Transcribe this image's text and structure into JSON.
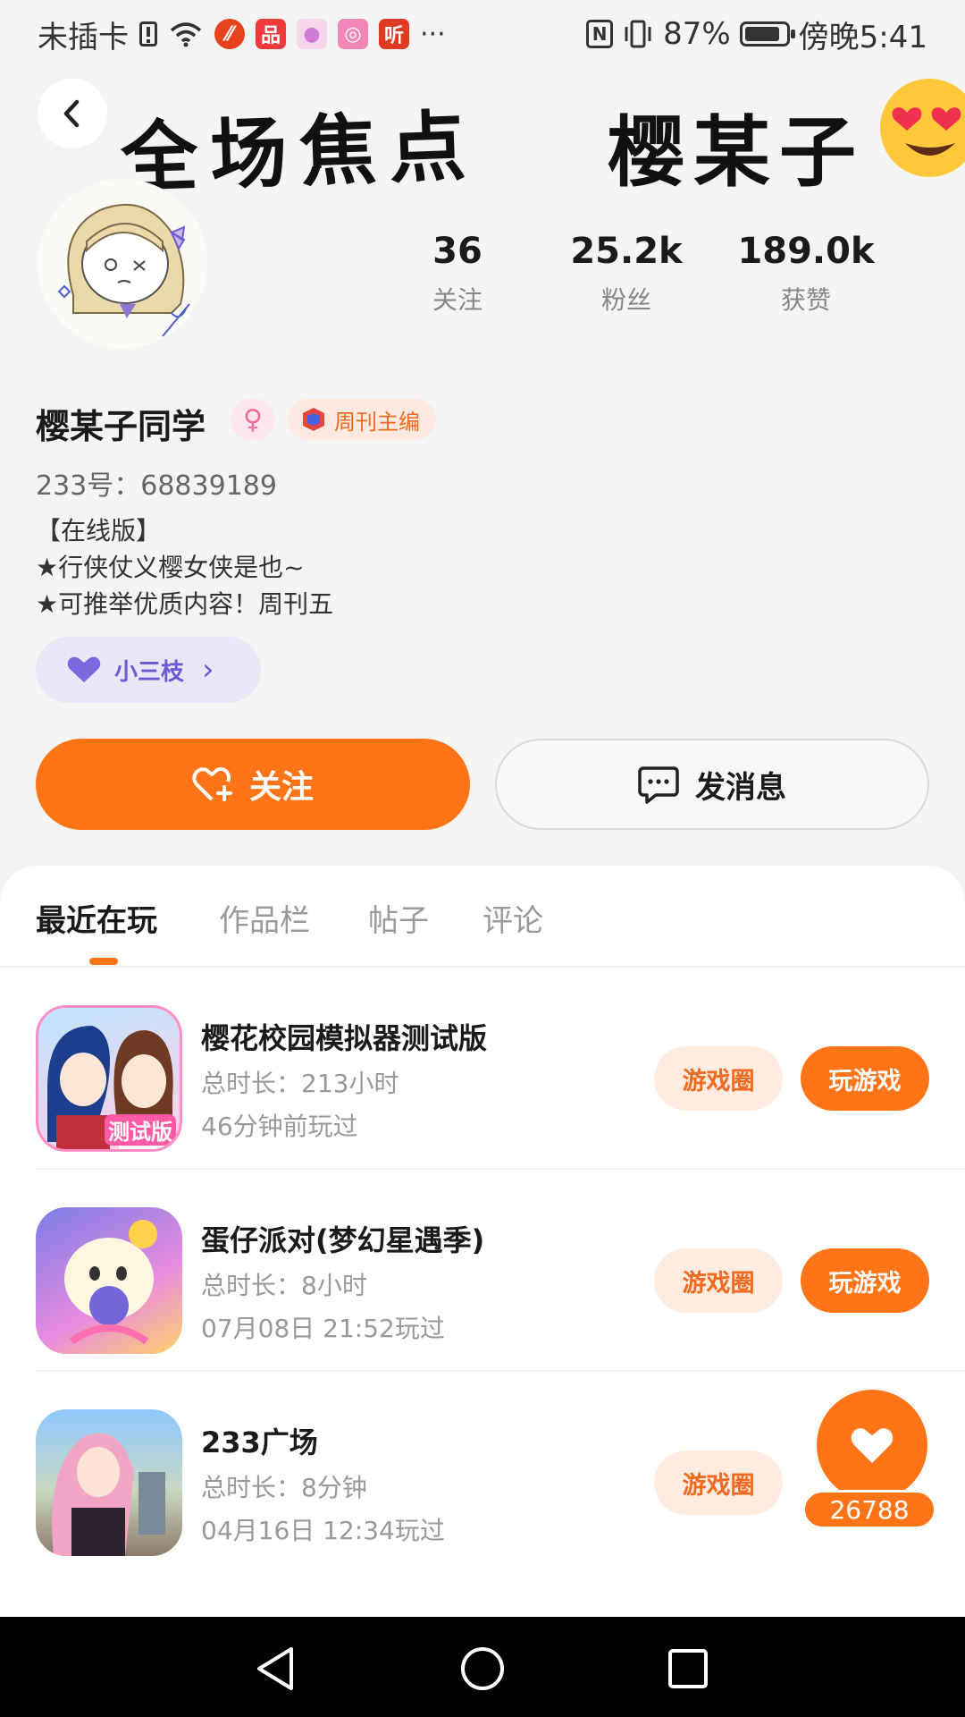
{
  "status_bar": {
    "carrier": "未插卡",
    "app_icon_ting": "听",
    "more": "···",
    "battery": "87%",
    "battery_level": 0.87,
    "time": "傍晚5:41"
  },
  "banner": {
    "title": "全场焦点",
    "name": "樱某子"
  },
  "stats": [
    {
      "value": "36",
      "label": "关注"
    },
    {
      "value": "25.2k",
      "label": "粉丝"
    },
    {
      "value": "189.0k",
      "label": "获赞"
    }
  ],
  "profile": {
    "name": "樱某子同学",
    "gender_symbol": "♀",
    "editor_badge": "周刊主编",
    "id_line": "233号：68839189",
    "bio": [
      "【在线版】",
      "★行侠仗义樱女侠是也~",
      "★可推举优质内容！周刊五"
    ],
    "fan_group": "小三枝",
    "fan_group_chevron": "›"
  },
  "actions": {
    "follow": "关注",
    "message": "发消息"
  },
  "tabs": [
    "最近在玩",
    "作品栏",
    "帖子",
    "评论"
  ],
  "games": [
    {
      "title": "樱花校园模拟器测试版",
      "duration": "总时长：213小时",
      "last_played": "46分钟前玩过",
      "icon_label": "测试版",
      "circle": "游戏圈",
      "play": "玩游戏"
    },
    {
      "title": "蛋仔派对(梦幻星遇季)",
      "duration": "总时长：8小时",
      "last_played": "07月08日 21:52玩过",
      "circle": "游戏圈",
      "play": "玩游戏"
    },
    {
      "title": "233广场",
      "duration": "总时长：8分钟",
      "last_played": "04月16日 12:34玩过",
      "circle": "游戏圈"
    }
  ],
  "floating_like": {
    "count": "26788"
  },
  "colors": {
    "accent": "#ff7416",
    "accent_soft": "#ffebe0",
    "fan_purple": "#6b5ad4"
  }
}
